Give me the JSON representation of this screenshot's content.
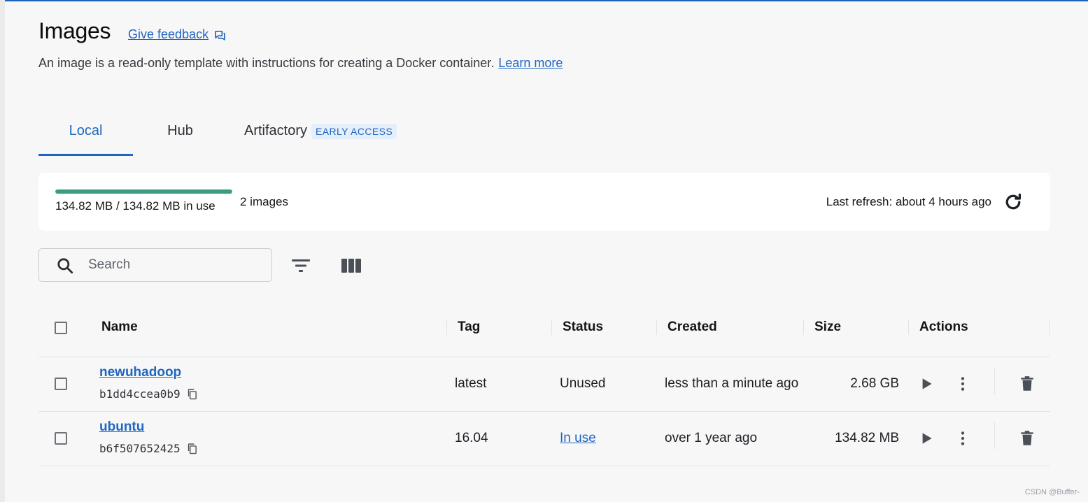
{
  "page": {
    "title": "Images",
    "feedback_label": "Give feedback",
    "subtitle": "An image is a read-only template with instructions for creating a Docker container.",
    "learn_more": "Learn more"
  },
  "tabs": [
    {
      "label": "Local",
      "active": true
    },
    {
      "label": "Hub",
      "active": false
    },
    {
      "label": "Artifactory",
      "badge": "EARLY ACCESS",
      "active": false
    }
  ],
  "summary": {
    "usage_text": "134.82 MB / 134.82 MB in use",
    "usage_fraction": 1.0,
    "usage_color": "#3b9c83",
    "image_count": "2 images",
    "last_refresh": "Last refresh: about 4 hours ago"
  },
  "toolbar": {
    "search_placeholder": "Search"
  },
  "table": {
    "columns": [
      "Name",
      "Tag",
      "Status",
      "Created",
      "Size",
      "Actions"
    ],
    "rows": [
      {
        "name": "newuhadoop",
        "id": "b1dd4ccea0b9",
        "tag": "latest",
        "status": "Unused",
        "created": "less than a minute ago",
        "size": "2.68 GB"
      },
      {
        "name": "ubuntu",
        "id": "b6f507652425",
        "tag": "16.04",
        "status": "In use",
        "created": "over 1 year ago",
        "size": "134.82 MB"
      }
    ]
  },
  "watermark": "CSDN @Buffer-",
  "colors": {
    "accent": "#1f66c1",
    "background": "#f7f7f8",
    "card": "#ffffff",
    "text": "#141516"
  }
}
